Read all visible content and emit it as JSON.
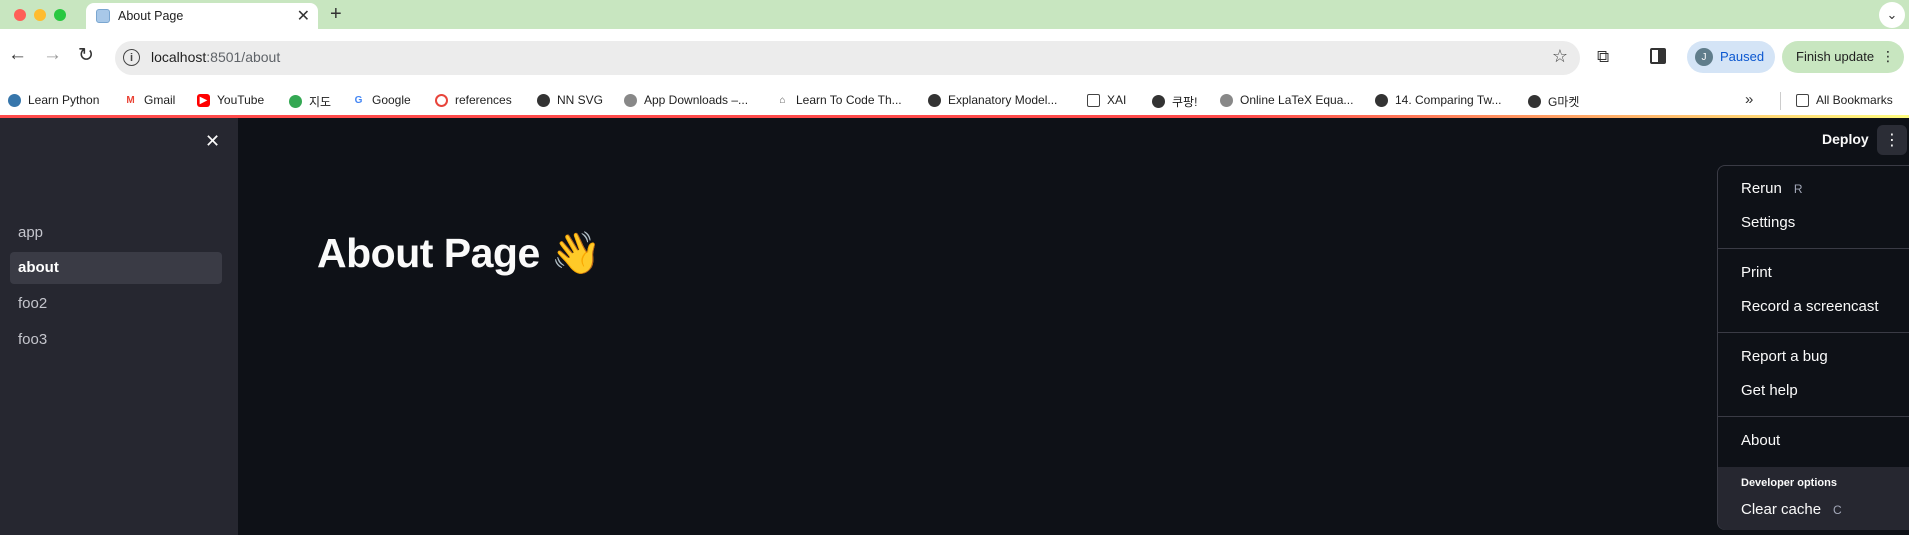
{
  "browser": {
    "tab_title": "About Page",
    "tab_close": "✕",
    "new_tab": "+",
    "tabs_menu": "⌄",
    "url_host": "localhost",
    "url_path": ":8501/about",
    "profile_initial": "J",
    "profile_label": "Paused",
    "update_label": "Finish update",
    "bookmarks": [
      {
        "label": "Learn Python",
        "icon": "python-icon"
      },
      {
        "label": "Gmail",
        "icon": "gmail-icon"
      },
      {
        "label": "YouTube",
        "icon": "youtube-icon"
      },
      {
        "label": "지도",
        "icon": "maps-icon"
      },
      {
        "label": "Google",
        "icon": "google-icon"
      },
      {
        "label": "references",
        "icon": "ring-icon"
      },
      {
        "label": "NN SVG",
        "icon": "globe-icon"
      },
      {
        "label": "App Downloads –...",
        "icon": "gear-icon"
      },
      {
        "label": "Learn To Code Th...",
        "icon": "cap-icon"
      },
      {
        "label": "Explanatory Model...",
        "icon": "globe-icon"
      },
      {
        "label": "XAI",
        "icon": "folder-icon"
      },
      {
        "label": "쿠팡!",
        "icon": "globe-icon"
      },
      {
        "label": "Online LaTeX Equa...",
        "icon": "gear-icon"
      },
      {
        "label": "14. Comparing Tw...",
        "icon": "globe-icon"
      },
      {
        "label": "G마켓",
        "icon": "globe-icon"
      }
    ],
    "all_bookmarks": "All Bookmarks"
  },
  "sidebar": {
    "items": [
      {
        "label": "app"
      },
      {
        "label": "about"
      },
      {
        "label": "foo2"
      },
      {
        "label": "foo3"
      }
    ],
    "active_index": 1
  },
  "header": {
    "deploy_label": "Deploy"
  },
  "main": {
    "title": "About Page 👋"
  },
  "menu": {
    "rerun": {
      "label": "Rerun",
      "key": "R"
    },
    "settings": "Settings",
    "print": "Print",
    "record": "Record a screencast",
    "report_bug": "Report a bug",
    "get_help": "Get help",
    "about": "About",
    "dev_title": "Developer options",
    "clear_cache": {
      "label": "Clear cache",
      "key": "C"
    }
  },
  "colors": {
    "app_bg": "#0e1117",
    "sidebar_bg": "#262730",
    "accent": "#ff4b4b",
    "tabstrip": "#c8e6c0"
  }
}
